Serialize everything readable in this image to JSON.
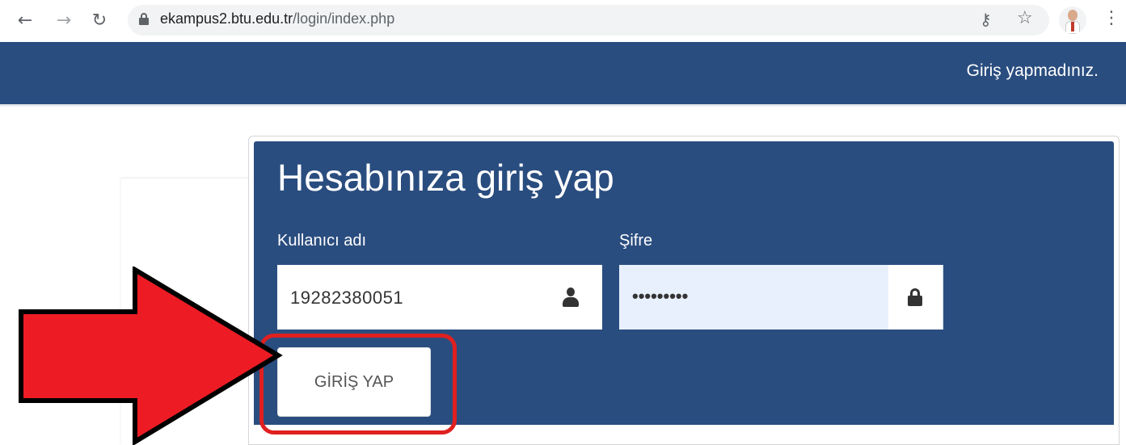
{
  "browser": {
    "back_icon": "arrow-left-icon",
    "forward_icon": "arrow-right-icon",
    "reload_icon": "reload-icon",
    "url_host": "ekampus2.btu.edu.tr",
    "url_path": "/login/index.php",
    "key_icon": "key-icon",
    "star_icon": "star-icon",
    "menu_icon": "more-vert-icon"
  },
  "header": {
    "login_status": "Giriş yapmadınız."
  },
  "login": {
    "title": "Hesabınıza giriş yap",
    "username_label": "Kullanıcı adı",
    "username_value": "19282380051",
    "password_label": "Şifre",
    "password_value": "•••••••••",
    "submit_label": "GİRİŞ YAP"
  },
  "annotation": {
    "arrow_color": "#ed1c24",
    "ring_color": "#e02020"
  },
  "colors": {
    "brand_navy": "#2a4d7f",
    "autofill_bg": "#e8f0fe"
  }
}
